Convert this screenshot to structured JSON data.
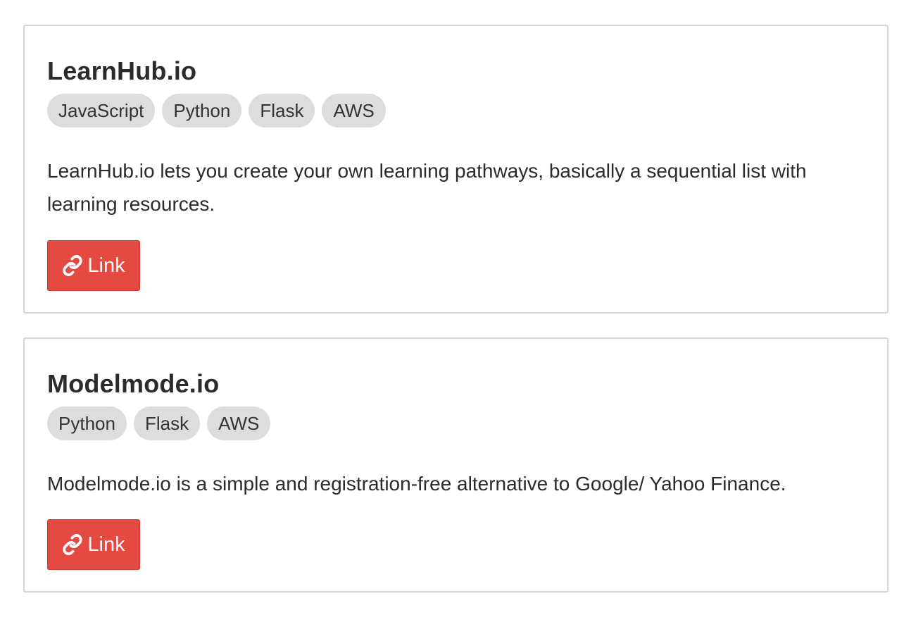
{
  "projects": [
    {
      "title": "LearnHub.io",
      "tags": [
        "JavaScript",
        "Python",
        "Flask",
        "AWS"
      ],
      "description": "LearnHub.io lets you create your own learning pathways, basically a sequential list with learning resources.",
      "link_label": "Link",
      "link_icon": "link-chain-icon"
    },
    {
      "title": "Modelmode.io",
      "tags": [
        "Python",
        "Flask",
        "AWS"
      ],
      "description": "Modelmode.io is a simple and registration-free alternative to Google/ Yahoo Finance.",
      "link_label": "Link",
      "link_icon": "link-chain-icon"
    }
  ],
  "colors": {
    "button_bg": "#e54a42",
    "tag_bg": "#dddddd",
    "card_border": "#d4d4d4"
  }
}
